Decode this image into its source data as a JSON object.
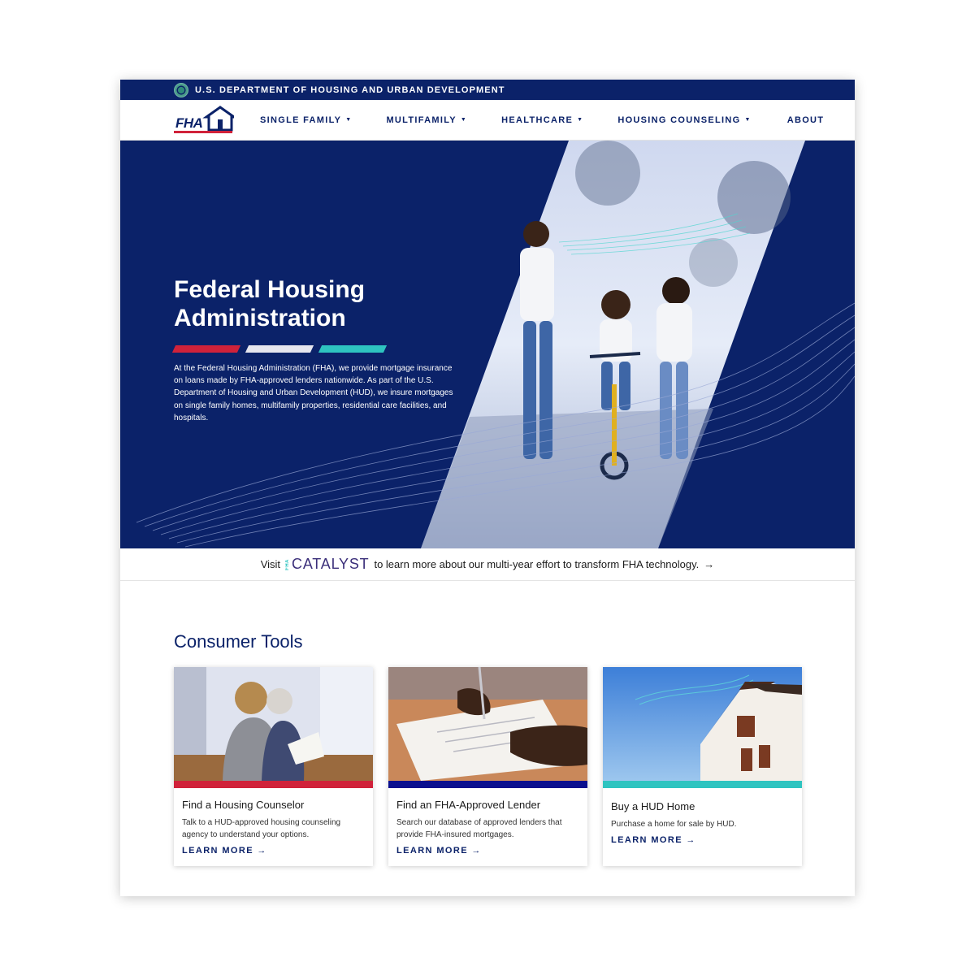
{
  "gov_banner": {
    "text": "U.S. DEPARTMENT OF HOUSING AND URBAN DEVELOPMENT"
  },
  "logo": {
    "text": "FHA"
  },
  "nav": {
    "items": [
      {
        "label": "SINGLE FAMILY",
        "caret": "▼"
      },
      {
        "label": "MULTIFAMILY",
        "caret": "▼"
      },
      {
        "label": "HEALTHCARE",
        "caret": "▼"
      },
      {
        "label": "HOUSING COUNSELING",
        "caret": "▼"
      },
      {
        "label": "ABOUT"
      }
    ]
  },
  "hero": {
    "title_line1": "Federal Housing",
    "title_line2": "Administration",
    "description": "At the Federal Housing Administration (FHA), we provide mortgage insurance on loans made by FHA-approved lenders nationwide. As part of the U.S. Department of Housing and Urban Development (HUD), we insure mortgages on single family homes, multifamily properties, residential care facilities, and hospitals.",
    "stripe_colors": [
      "#d0223a",
      "#e6e6ee",
      "#2ec4c0"
    ]
  },
  "catalyst": {
    "prefix": "Visit",
    "logo_small": "FHA",
    "logo_word": "CATALYST",
    "suffix": "to learn more about our multi-year effort to transform FHA technology.",
    "arrow": "→"
  },
  "consumer_tools": {
    "title": "Consumer Tools",
    "cards": [
      {
        "title": "Find a Housing Counselor",
        "description": "Talk to a HUD-approved housing counseling agency to understand your options.",
        "link": "LEARN MORE",
        "arrow": "→",
        "bar_color": "#d0223a"
      },
      {
        "title": "Find an FHA-Approved Lender",
        "description": "Search our database of approved lenders that provide FHA-insured mortgages.",
        "link": "LEARN MORE",
        "arrow": "→",
        "bar_color": "#0a0f8e"
      },
      {
        "title": "Buy a HUD Home",
        "description": "Purchase a home for sale by HUD.",
        "link": "LEARN MORE",
        "arrow": "→",
        "bar_color": "#2ec4c0"
      }
    ]
  },
  "colors": {
    "navy": "#0b2269",
    "red": "#d0223a",
    "teal": "#2ec4c0"
  }
}
